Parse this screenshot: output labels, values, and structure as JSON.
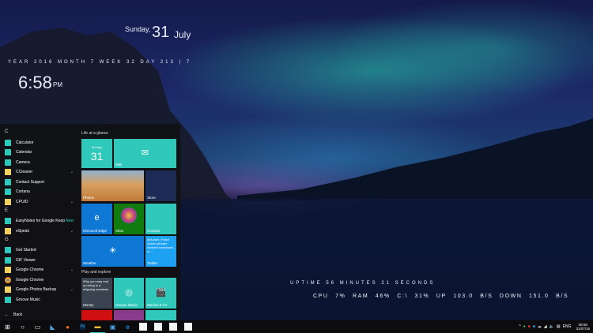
{
  "widgets": {
    "weekday": "Sunday,",
    "day": "31",
    "month": "July",
    "info": "YEAR 2016   MONTH 7   WEEK 32   DAY 213 | 7",
    "time": "6:58",
    "ampm": "PM",
    "uptime": "UPTIME 56 MINUTES 21 SECONDS",
    "stats": "CPU 7%     RAM 46%     C:\\ 31%     UP 103.0 B/S  DOWN 151.0 B/S"
  },
  "start": {
    "groups": [
      {
        "letter": "C",
        "items": [
          {
            "label": "Calculator"
          },
          {
            "label": "Calendar"
          },
          {
            "label": "Camera"
          },
          {
            "label": "CCleaner",
            "expand": "⌄"
          },
          {
            "label": "Contact Support"
          },
          {
            "label": "Cortana"
          },
          {
            "label": "CPUID",
            "expand": "⌄"
          }
        ]
      },
      {
        "letter": "E",
        "items": [
          {
            "label": "EasyNotes for Google Keep",
            "badge": "New"
          },
          {
            "label": "eSpeak",
            "expand": "⌄"
          }
        ]
      },
      {
        "letter": "G",
        "items": [
          {
            "label": "Get Started"
          },
          {
            "label": "GIF Viewer"
          },
          {
            "label": "Google Chrome",
            "expand": "⌄"
          },
          {
            "label": "Google Chrome"
          },
          {
            "label": "Google Photos Backup",
            "expand": "⌄"
          },
          {
            "label": "Groove Music"
          }
        ]
      }
    ],
    "back": "Back",
    "section1": "Life at a glance",
    "section2": "Play and explore",
    "tiles": {
      "cal_day": "Sunday",
      "cal_num": "31",
      "mail": "Mail",
      "photos": "Photos",
      "store": "Store",
      "edge": "Microsoft Edge",
      "xbox": "Xbox",
      "cortana": "Cortana",
      "weather": "Weather",
      "twitter_text": "@Austin_Police Active shooter incident downtown, m...",
      "twitter": "Twitter",
      "money_text": "Why you may end up living in a shipping container",
      "money": "Money",
      "groove": "Groove Music",
      "movies": "Movies & TV"
    }
  },
  "taskbar": {
    "lang": "ENG",
    "clock_time": "06:58",
    "clock_date": "31/07/16"
  },
  "colors": {
    "tile": "#2fc8bb",
    "edge": "#0f78d4",
    "xbox": "#107c10",
    "accent": "#2fc8bb"
  }
}
